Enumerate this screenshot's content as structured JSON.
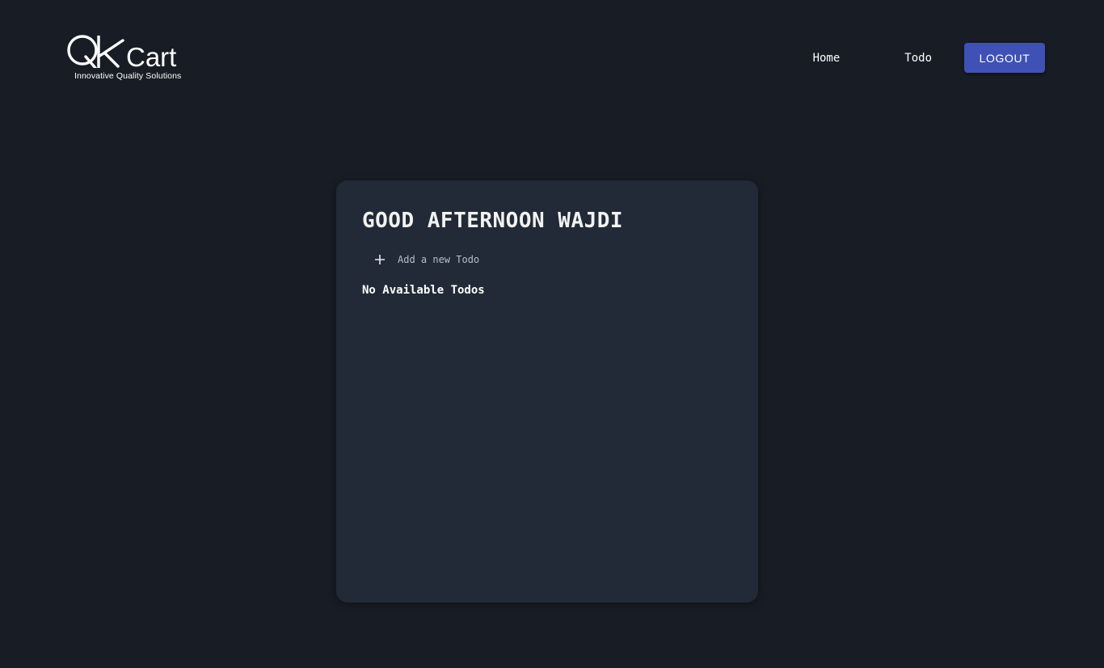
{
  "header": {
    "logo": {
      "brand_text": "QKart",
      "tagline": "Innovative Quality Solutions"
    },
    "nav": {
      "home_label": "Home",
      "todo_label": "Todo",
      "logout_label": "LOGOUT"
    }
  },
  "main": {
    "greeting": "GOOD AFTERNOON WAJDI",
    "add_todo_label": "Add a new Todo",
    "empty_message": "No Available Todos"
  },
  "icons": {
    "add": "plus-icon"
  },
  "colors": {
    "background": "#181c24",
    "card": "#212a36",
    "accent": "#3f51b5"
  }
}
